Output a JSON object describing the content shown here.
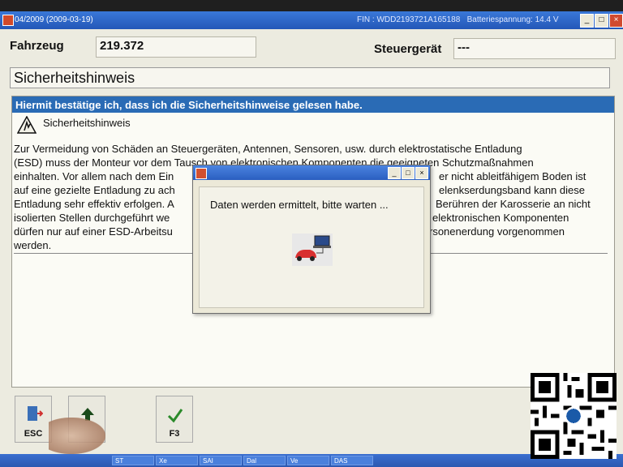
{
  "window": {
    "title": "04/2009 (2009-03-19)",
    "fin_info": "FIN : WDD2193721A165188",
    "battery_info": "Batteriespannung: 14.4 V"
  },
  "vehicle": {
    "label": "Fahrzeug",
    "value": "219.372",
    "ecu_label": "Steuergerät",
    "ecu_value": "---"
  },
  "section": {
    "title": "Sicherheitshinweis"
  },
  "content": {
    "confirm_bar": "Hiermit bestätige ich, dass ich die Sicherheitshinweise gelesen habe.",
    "warning_title": "Sicherheitshinweis",
    "lines": [
      "Zur Vermeidung von Schäden an Steuergeräten, Antennen, Sensoren, usw. durch elektrostatische Entladung",
      "(ESD) muss der Monteur vor dem Tausch von elektronischen Komponenten die geeigneten Schutzmaßnahmen",
      "einhalten. Vor allem nach dem Ein",
      "auf eine gezielte Entladung zu ach",
      "Entladung sehr effektiv erfolgen. A",
      "isolierten Stellen durchgeführt we",
      "dürfen nur auf einer ESD-Arbeitsu",
      "werden."
    ],
    "lines_right": [
      "",
      "",
      "er nicht ableitfähigem Boden ist",
      "elenkserdungsband kann diese",
      "Berühren der Karosserie an nicht",
      "elektronischen Komponenten",
      "rsonenerdung vorgenommen",
      ""
    ]
  },
  "dialog": {
    "message": "Daten werden ermittelt, bitte warten ...",
    "btn_min": "_",
    "btn_max": "□",
    "btn_close": "×"
  },
  "fkeys": [
    {
      "label": "ESC",
      "icon": "esc-door-icon"
    },
    {
      "label": "",
      "icon": "arrow-up-icon"
    },
    {
      "label": "F3",
      "icon": "checkmark-icon"
    }
  ],
  "taskbar": {
    "items": [
      "ST",
      "Xe",
      "SAI",
      "Dal",
      "Ve",
      "DAS"
    ]
  },
  "colors": {
    "title_blue": "#2357b8",
    "confirm_blue": "#2a6bb5"
  }
}
